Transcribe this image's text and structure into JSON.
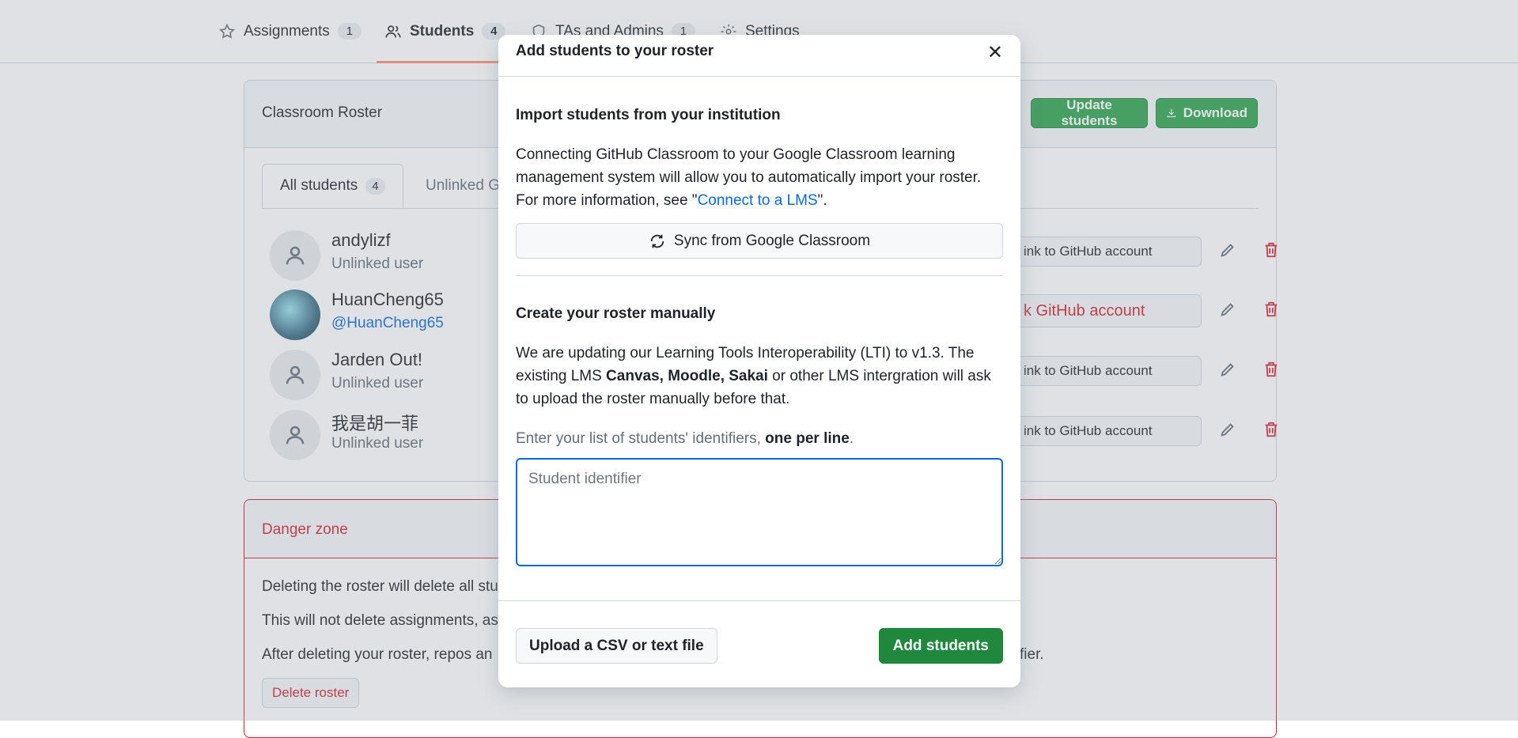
{
  "topnav": {
    "tabs": [
      {
        "label": "Assignments",
        "count": "1",
        "icon": "star-icon"
      },
      {
        "label": "Students",
        "count": "4",
        "icon": "people-icon"
      },
      {
        "label": "TAs and Admins",
        "count": "1",
        "icon": "shield-icon"
      },
      {
        "label": "Settings",
        "icon": "gear-icon"
      }
    ],
    "active_tab": "Students"
  },
  "roster": {
    "title": "Classroom Roster",
    "update_button": "Update students",
    "download_button": "Download",
    "tabs": [
      {
        "label": "All students",
        "count": "4"
      },
      {
        "label": "Unlinked G"
      }
    ],
    "students": [
      {
        "name": "andylizf",
        "status": "Unlinked user",
        "action": "ink to GitHub account"
      },
      {
        "name": "HuanCheng65",
        "status": "@HuanCheng65",
        "action": "k GitHub account"
      },
      {
        "name": "Jarden Out!",
        "status": "Unlinked user",
        "action": "ink to GitHub account"
      },
      {
        "name": "我是胡一菲",
        "status": "Unlinked user",
        "action": "ink to GitHub account"
      }
    ]
  },
  "danger": {
    "title": "Danger zone",
    "lines": [
      "Deleting the roster will delete all stu",
      "This will not delete assignments, as",
      "After deleting your roster, repos an"
    ],
    "line3_tail": "fier.",
    "delete_button": "Delete roster"
  },
  "modal": {
    "title": "Add students to your roster",
    "import_heading": "Import students from your institution",
    "import_text_1": "Connecting GitHub Classroom to your Google Classroom learning management system will allow you to automatically import your roster. For more information, see \"",
    "import_link": "Connect to a LMS",
    "import_text_2": "\".",
    "sync_button": "Sync from Google Classroom",
    "manual_heading": "Create your roster manually",
    "manual_text_1": "We are updating our Learning Tools Interoperability (LTI) to v1.3. The existing LMS ",
    "manual_bold": "Canvas, Moodle, Sakai",
    "manual_text_2": " or other LMS intergration will ask to upload the roster manually before that.",
    "hint_text": "Enter your list of students' identifiers, ",
    "hint_bold": "one per line",
    "hint_end": ".",
    "textarea_placeholder": "Student identifier",
    "textarea_value": "",
    "upload_button": "Upload a CSV or text file",
    "add_button": "Add students"
  }
}
